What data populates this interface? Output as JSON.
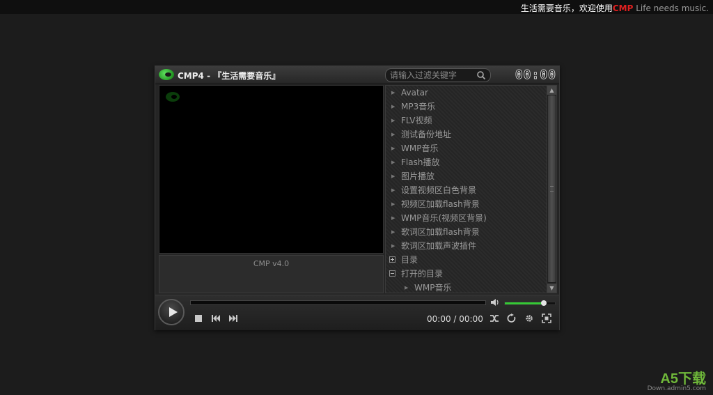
{
  "topbar": {
    "text_prefix": "生活需要音乐，欢迎使用",
    "text_brand": "CMP",
    "text_suffix": " Life needs music."
  },
  "player": {
    "title": "CMP4 - 『生活需要音乐』",
    "search_placeholder": "请输入过滤关键字",
    "timer": "00:00",
    "lyric_text": "CMP v4.0",
    "time_display": "00:00 / 00:00",
    "volume_level": 0.78,
    "progress": 0
  },
  "playlist": {
    "items": [
      {
        "label": "Avatar",
        "kind": "item"
      },
      {
        "label": "MP3音乐",
        "kind": "item"
      },
      {
        "label": "FLV视频",
        "kind": "item"
      },
      {
        "label": "测试备份地址",
        "kind": "item"
      },
      {
        "label": "WMP音乐",
        "kind": "item"
      },
      {
        "label": "Flash播放",
        "kind": "item"
      },
      {
        "label": "图片播放",
        "kind": "item"
      },
      {
        "label": "设置视频区白色背景",
        "kind": "item"
      },
      {
        "label": "视频区加载flash背景",
        "kind": "item"
      },
      {
        "label": "WMP音乐(视频区背景)",
        "kind": "item"
      },
      {
        "label": "歌词区加载flash背景",
        "kind": "item"
      },
      {
        "label": "歌词区加载声波插件",
        "kind": "item"
      },
      {
        "label": "目录",
        "kind": "folder-closed"
      },
      {
        "label": "打开的目录",
        "kind": "folder-open"
      },
      {
        "label": "WMP音乐",
        "kind": "sub"
      }
    ]
  },
  "watermark": {
    "logo": "A5下载",
    "url": "Down.admin5.com"
  },
  "colors": {
    "background": "#1c1c1c",
    "brand_red": "#e02020",
    "volume_green": "#35c935"
  }
}
